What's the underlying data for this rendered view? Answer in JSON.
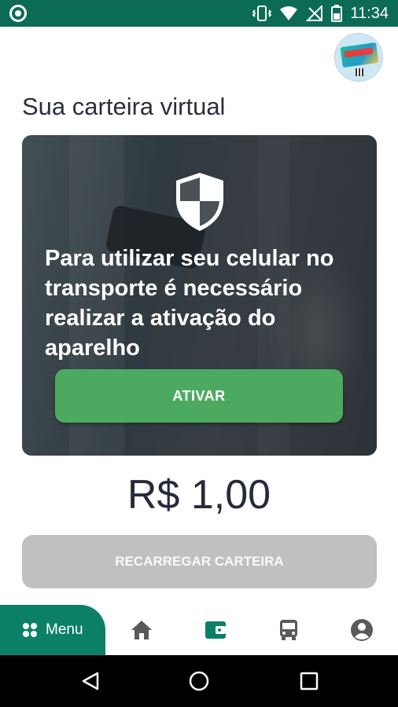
{
  "status_bar": {
    "time": "11:34",
    "icons": [
      "circle-notification-icon",
      "vibrate-icon",
      "wifi-icon",
      "no-signal-icon",
      "battery-icon"
    ]
  },
  "header": {
    "avatar": "transit-card-avatar-icon",
    "title": "Sua carteira virtual"
  },
  "activation_card": {
    "icon": "shield-icon",
    "message": "Para utilizar seu celular no transporte é necessário realizar a ativação do aparelho",
    "button_label": "ATIVAR"
  },
  "wallet": {
    "balance": "R$ 1,00",
    "recharge_label": "RECARREGAR CARTEIRA"
  },
  "bottom_nav": {
    "menu_label": "Menu",
    "items": [
      "home-icon",
      "wallet-icon",
      "bus-icon",
      "account-icon"
    ],
    "active": "wallet-icon"
  },
  "system_nav": [
    "back-icon",
    "home-circle-icon",
    "recents-icon"
  ],
  "colors": {
    "status_bar": "#0c6b55",
    "accent": "#0c7f67",
    "activate_button": "#4caa60",
    "disabled_button": "#c0c0c0",
    "text_dark": "#262a3b"
  }
}
